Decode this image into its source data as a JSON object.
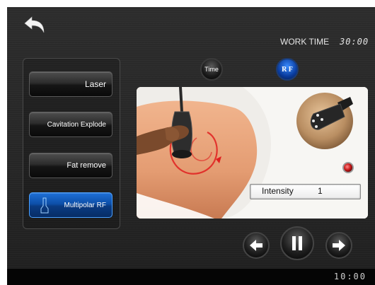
{
  "header": {
    "work_time_label": "WORK TIME",
    "work_time_value": "30:00"
  },
  "icons": {
    "back": "back-arrow-icon",
    "prev": "left-arrow-icon",
    "pause": "pause-icon",
    "next": "right-arrow-icon",
    "handle": "rf-handpiece-icon"
  },
  "sidebar": {
    "items": [
      {
        "label": "Laser",
        "active": false
      },
      {
        "label": "Cavitation Explode",
        "active": false
      },
      {
        "label": "Fat remove",
        "active": false
      },
      {
        "label": "Multipolar RF",
        "active": true
      }
    ]
  },
  "mode_buttons": {
    "time_label": "Time",
    "rf_label": "R F"
  },
  "panel": {
    "intensity_label": "Intensity",
    "intensity_value": "1"
  },
  "status_bar": {
    "clock": "10:00"
  },
  "colors": {
    "accent_blue": "#0d4fa8",
    "background": "#262626",
    "led_red": "#c81818"
  }
}
